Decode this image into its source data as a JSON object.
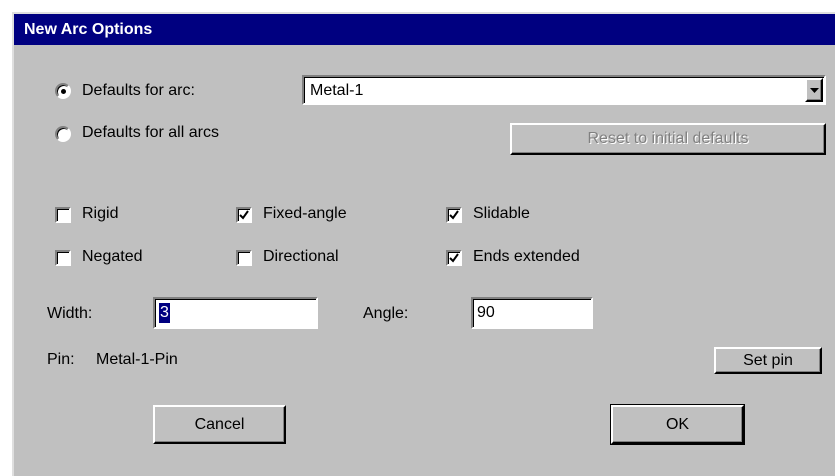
{
  "window": {
    "title": "New Arc Options"
  },
  "scope": {
    "arc_radio_label": "Defaults for arc:",
    "all_radio_label": "Defaults for all arcs",
    "selected": "arc",
    "arc_select_value": "Metal-1",
    "reset_button_label": "Reset to initial defaults",
    "reset_enabled": false
  },
  "flags": {
    "rigid": {
      "label": "Rigid",
      "checked": false
    },
    "fixed_angle": {
      "label": "Fixed-angle",
      "checked": true
    },
    "slidable": {
      "label": "Slidable",
      "checked": true
    },
    "negated": {
      "label": "Negated",
      "checked": false
    },
    "directional": {
      "label": "Directional",
      "checked": false
    },
    "ends_extended": {
      "label": "Ends extended",
      "checked": true
    }
  },
  "fields": {
    "width_label": "Width:",
    "width_value": "3",
    "angle_label": "Angle:",
    "angle_value": "90"
  },
  "pin": {
    "label": "Pin:",
    "value": "Metal-1-Pin",
    "set_button_label": "Set pin"
  },
  "actions": {
    "cancel_label": "Cancel",
    "ok_label": "OK"
  },
  "colors": {
    "titlebar": "#000080",
    "face": "#c0c0c0"
  },
  "icons": {
    "dropdown": "chevron-down-icon",
    "check": "checkmark-icon"
  }
}
